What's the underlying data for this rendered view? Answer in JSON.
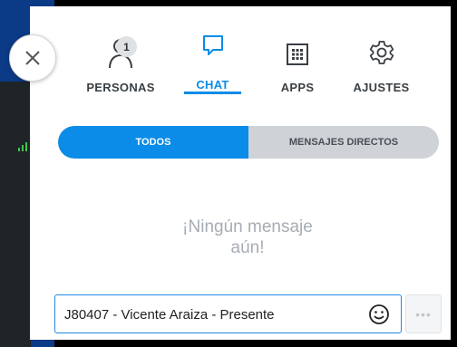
{
  "tabs": [
    {
      "label": "PERSONAS",
      "icon": "person-icon",
      "badge": "1"
    },
    {
      "label": "CHAT",
      "icon": "chat-bubble-icon"
    },
    {
      "label": "APPS",
      "icon": "apps-grid-icon"
    },
    {
      "label": "AJUSTES",
      "icon": "gear-icon"
    }
  ],
  "filters": {
    "active": "TODOS",
    "other": "MENSAJES DIRECTOS"
  },
  "empty_state": {
    "line1": "¡Ningún mensaje",
    "line2": "aún!"
  },
  "composer": {
    "value": "J80407 - Vicente Araiza - Presente"
  },
  "more_label": "•••",
  "colors": {
    "accent": "#0a8ce8",
    "signal": "#3ec74a"
  }
}
